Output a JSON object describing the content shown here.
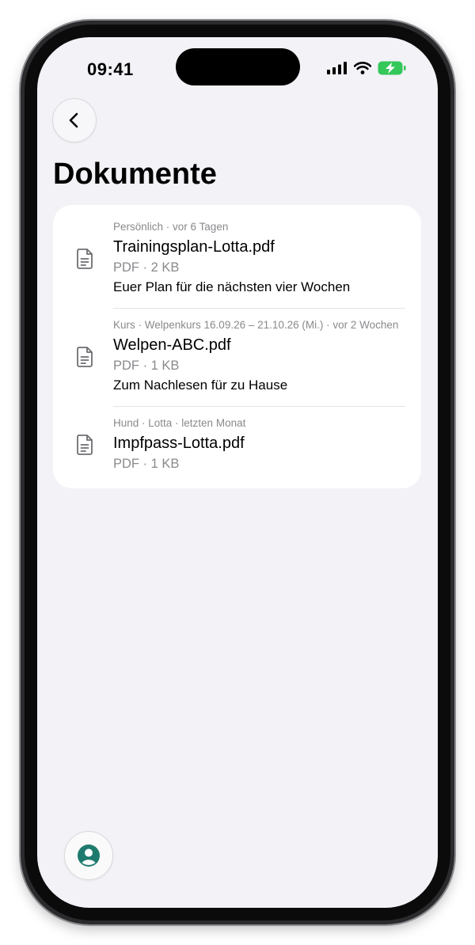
{
  "status_bar": {
    "time": "09:41",
    "icons": [
      "signal-icon",
      "wifi-icon",
      "battery-charging-icon"
    ],
    "battery_color": "#34c759"
  },
  "header": {
    "back_icon": "chevron-left-icon",
    "title": "Dokumente"
  },
  "documents": [
    {
      "meta": "Persönlich · vor 6 Tagen",
      "name": "Trainingsplan-Lotta.pdf",
      "size": "PDF · 2 KB",
      "description": "Euer Plan für die nächsten vier Wochen",
      "icon": "document-icon"
    },
    {
      "meta": "Kurs · Welpenkurs 16.09.26 – 21.10.26 (Mi.) · vor 2 Wochen",
      "name": "Welpen-ABC.pdf",
      "size": "PDF · 1 KB",
      "description": "Zum Nachlesen für zu Hause",
      "icon": "document-icon"
    },
    {
      "meta": "Hund · Lotta · letzten Monat",
      "name": "Impfpass-Lotta.pdf",
      "size": "PDF · 1 KB",
      "icon": "document-icon"
    }
  ],
  "footer": {
    "profile_icon": "user-profile-icon",
    "accent_color": "#1f7a6e"
  }
}
